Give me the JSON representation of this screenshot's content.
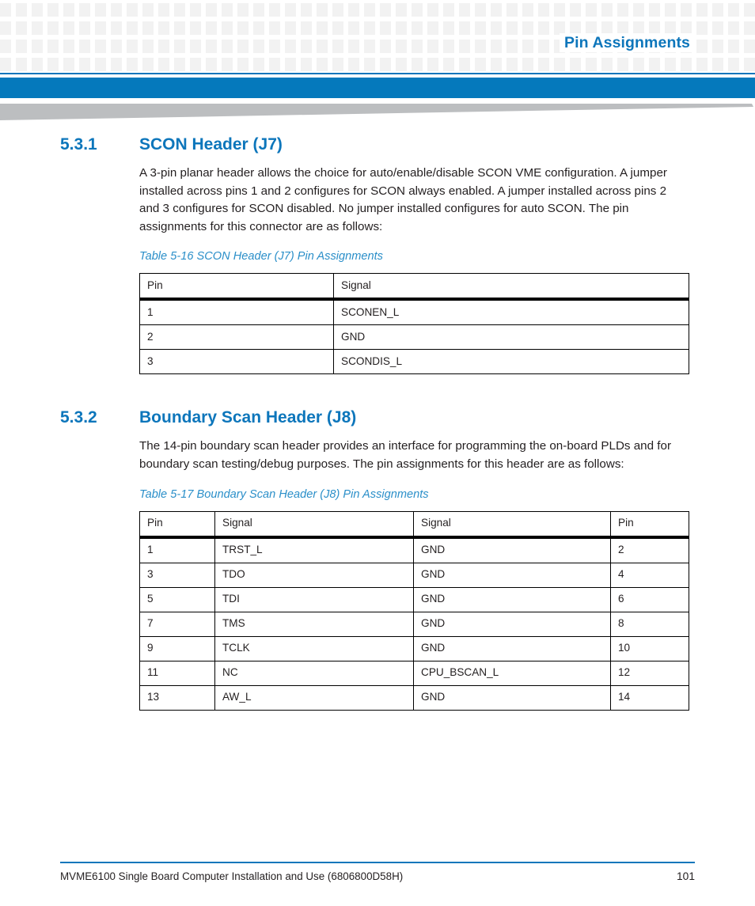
{
  "header": {
    "running_head": "Pin Assignments",
    "accent_color": "#0d76bb",
    "band_color": "#0579bc",
    "wedge_color": "#bcbec0",
    "pattern_color": "#f2f2f2"
  },
  "sections": [
    {
      "number": "5.3.1",
      "title": "SCON Header (J7)",
      "paragraph": "A 3-pin planar header allows the choice for auto/enable/disable SCON VME configuration. A jumper installed across pins 1 and 2 configures for SCON always enabled. A jumper installed across pins 2 and 3 configures for SCON disabled. No jumper installed configures for auto SCON. The pin assignments for this connector are as follows:",
      "table_caption": "Table 5-16 SCON Header (J7) Pin Assignments",
      "table": {
        "columns": [
          "Pin",
          "Signal"
        ],
        "rows": [
          [
            "1",
            "SCONEN_L"
          ],
          [
            "2",
            "GND"
          ],
          [
            "3",
            "SCONDIS_L"
          ]
        ]
      }
    },
    {
      "number": "5.3.2",
      "title": "Boundary Scan Header (J8)",
      "paragraph": "The 14-pin boundary scan header provides an interface for programming the on-board PLDs and for boundary scan testing/debug purposes. The pin assignments for this header are as follows:",
      "table_caption": "Table 5-17 Boundary Scan Header (J8) Pin Assignments",
      "table": {
        "columns": [
          "Pin",
          "Signal",
          "Signal",
          "Pin"
        ],
        "rows": [
          [
            "1",
            "TRST_L",
            "GND",
            "2"
          ],
          [
            "3",
            "TDO",
            "GND",
            "4"
          ],
          [
            "5",
            "TDI",
            "GND",
            "6"
          ],
          [
            "7",
            "TMS",
            "GND",
            "8"
          ],
          [
            "9",
            "TCLK",
            "GND",
            "10"
          ],
          [
            "11",
            "NC",
            "CPU_BSCAN_L",
            "12"
          ],
          [
            "13",
            "AW_L",
            "GND",
            "14"
          ]
        ]
      }
    }
  ],
  "footer": {
    "document_title": "MVME6100 Single Board Computer Installation and Use (6806800D58H)",
    "page_number": "101"
  }
}
